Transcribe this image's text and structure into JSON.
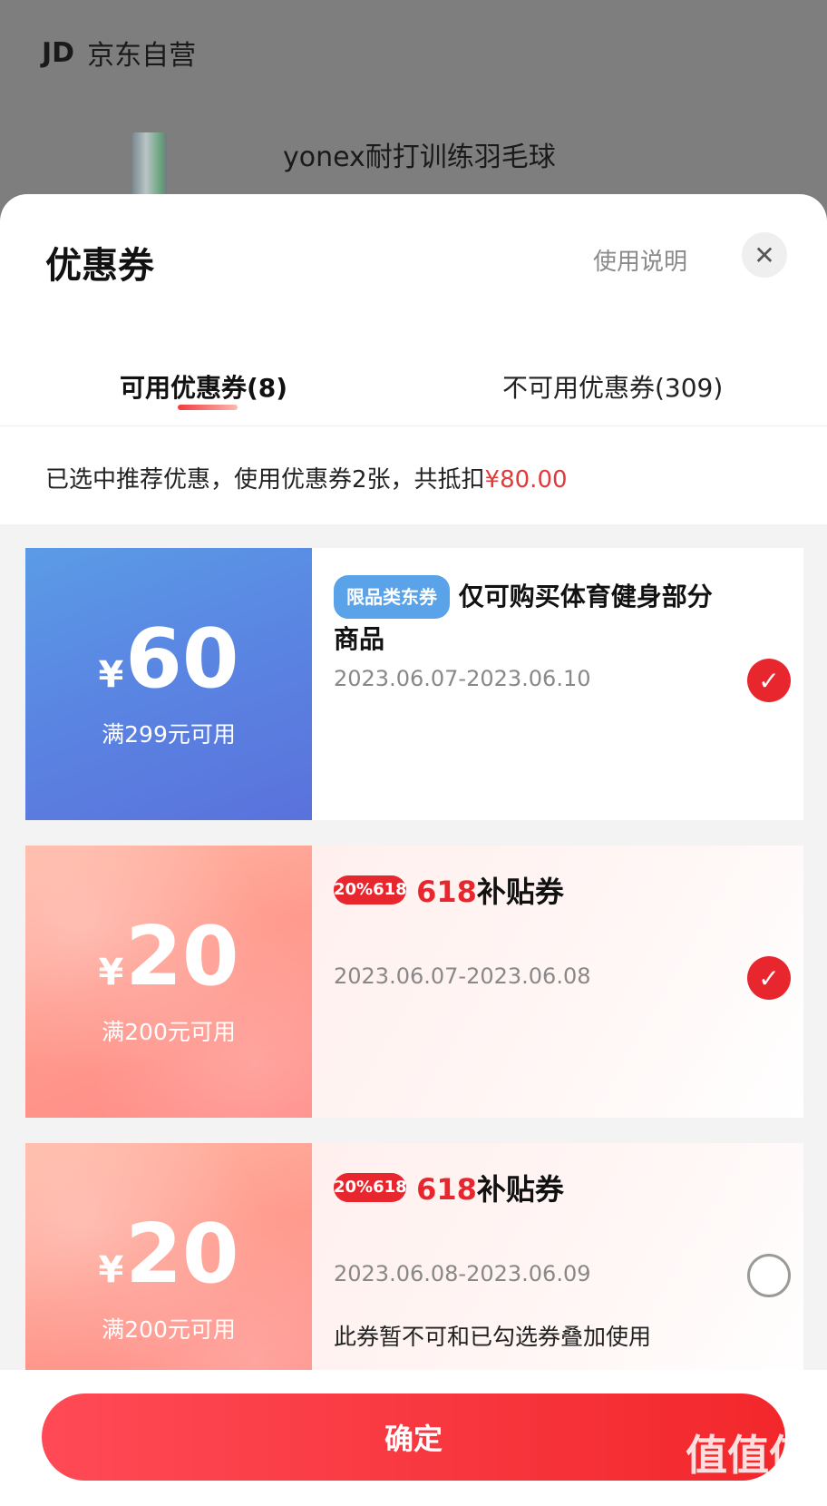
{
  "background": {
    "shop_logo": "JD",
    "shop_name": "京东自营",
    "product_title": "yonex耐打训练羽毛球"
  },
  "sheet": {
    "title": "优惠券",
    "usage_link": "使用说明",
    "close_icon": "close-icon"
  },
  "tabs": [
    {
      "label": "可用优惠券(8)",
      "active": true
    },
    {
      "label": "不可用优惠券(309)",
      "active": false
    }
  ],
  "summary": {
    "text": "已选中推荐优惠，使用优惠券2张，共抵扣",
    "amount": "¥80.00"
  },
  "coupons": [
    {
      "yen": "¥",
      "amount": "60",
      "condition": "满299元可用",
      "tag": "限品类东券",
      "title": "仅可购买体育健身部分商品",
      "date": "2023.06.07-2023.06.10",
      "selected": true
    },
    {
      "yen": "¥",
      "amount": "20",
      "condition": "满200元可用",
      "badge": "20%618",
      "title_prefix": "618",
      "title_suffix": "补贴券",
      "date": "2023.06.07-2023.06.08",
      "selected": true
    },
    {
      "yen": "¥",
      "amount": "20",
      "condition": "满200元可用",
      "badge": "20%618",
      "title_prefix": "618",
      "title_suffix": "补贴券",
      "date": "2023.06.08-2023.06.09",
      "note": "此券暂不可和已勾选券叠加使用",
      "selected": false
    }
  ],
  "footer": {
    "confirm_label": "确定"
  },
  "watermark": {
    "text": "值值值",
    "url": "zhizhizhi.com"
  },
  "colors": {
    "accent": "#e8262e",
    "blue_coupon": "#5a84e2",
    "pink_coupon": "#ff9b8e"
  }
}
